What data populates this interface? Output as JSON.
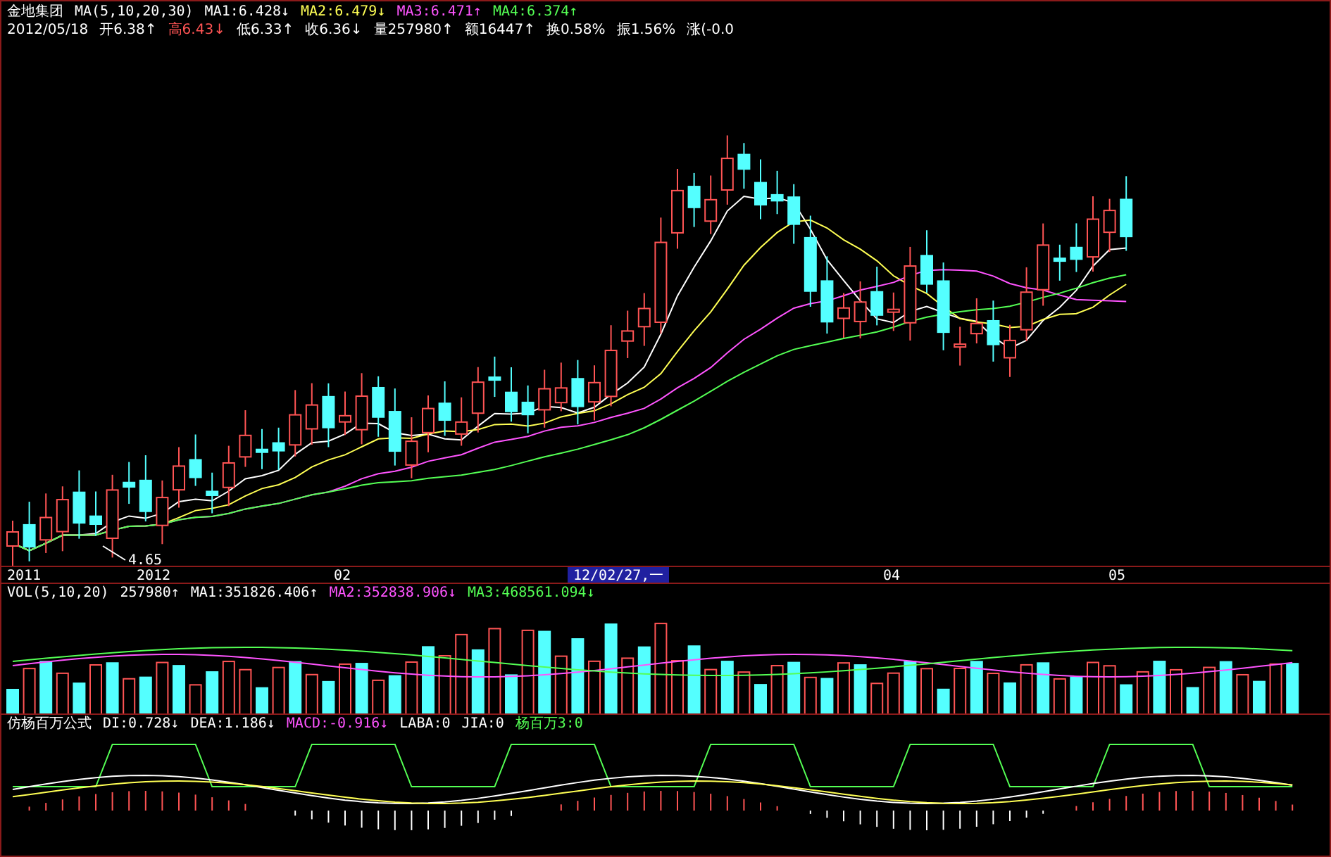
{
  "price_panel": {
    "title": "金地集团",
    "ma_label": "MA(5,10,20,30)",
    "ma_values": [
      {
        "text": "MA1:6.428↓",
        "color": "#ffffff"
      },
      {
        "text": "MA2:6.479↓",
        "color": "#ffff54"
      },
      {
        "text": "MA3:6.471↑",
        "color": "#ff54ff"
      },
      {
        "text": "MA4:6.374↑",
        "color": "#54ff54"
      }
    ],
    "date": "2012/05/18",
    "quotes": [
      {
        "text": "开6.38↑",
        "color": "#ffffff"
      },
      {
        "text": "高6.43↓",
        "color": "#ff5454"
      },
      {
        "text": "低6.33↑",
        "color": "#ffffff"
      },
      {
        "text": "收6.36↓",
        "color": "#ffffff"
      },
      {
        "text": "量257980↑",
        "color": "#ffffff"
      },
      {
        "text": "额16447↑",
        "color": "#ffffff"
      },
      {
        "text": "换0.58%",
        "color": "#ffffff"
      },
      {
        "text": "振1.56%",
        "color": "#ffffff"
      },
      {
        "text": "涨(-0.0",
        "color": "#ffffff"
      }
    ],
    "low_mark": "4.65"
  },
  "time_axis": {
    "labels": [
      {
        "text": "2011",
        "selected": false
      },
      {
        "text": "2012",
        "selected": false
      },
      {
        "text": "02",
        "selected": false
      },
      {
        "text": "12/02/27,一",
        "selected": true
      },
      {
        "text": "04",
        "selected": false
      },
      {
        "text": "05",
        "selected": false
      }
    ]
  },
  "volume_panel": {
    "label": "VOL(5,10,20)",
    "values": [
      {
        "text": "257980↑",
        "color": "#ffffff"
      },
      {
        "text": "MA1:351826.406↑",
        "color": "#ffffff"
      },
      {
        "text": "MA2:352838.906↓",
        "color": "#ff54ff"
      },
      {
        "text": "MA3:468561.094↓",
        "color": "#54ff54"
      }
    ]
  },
  "indicator_panel": {
    "title": "仿杨百万公式",
    "values": [
      {
        "text": "DI:0.728↓",
        "color": "#ffffff"
      },
      {
        "text": "DEA:1.186↓",
        "color": "#ffffff"
      },
      {
        "text": "MACD:-0.916↓",
        "color": "#ff54ff"
      },
      {
        "text": "LABA:0",
        "color": "#ffffff"
      },
      {
        "text": "JIA:0",
        "color": "#ffffff"
      },
      {
        "text": "杨百万3:0",
        "color": "#54ff54"
      }
    ]
  }
}
